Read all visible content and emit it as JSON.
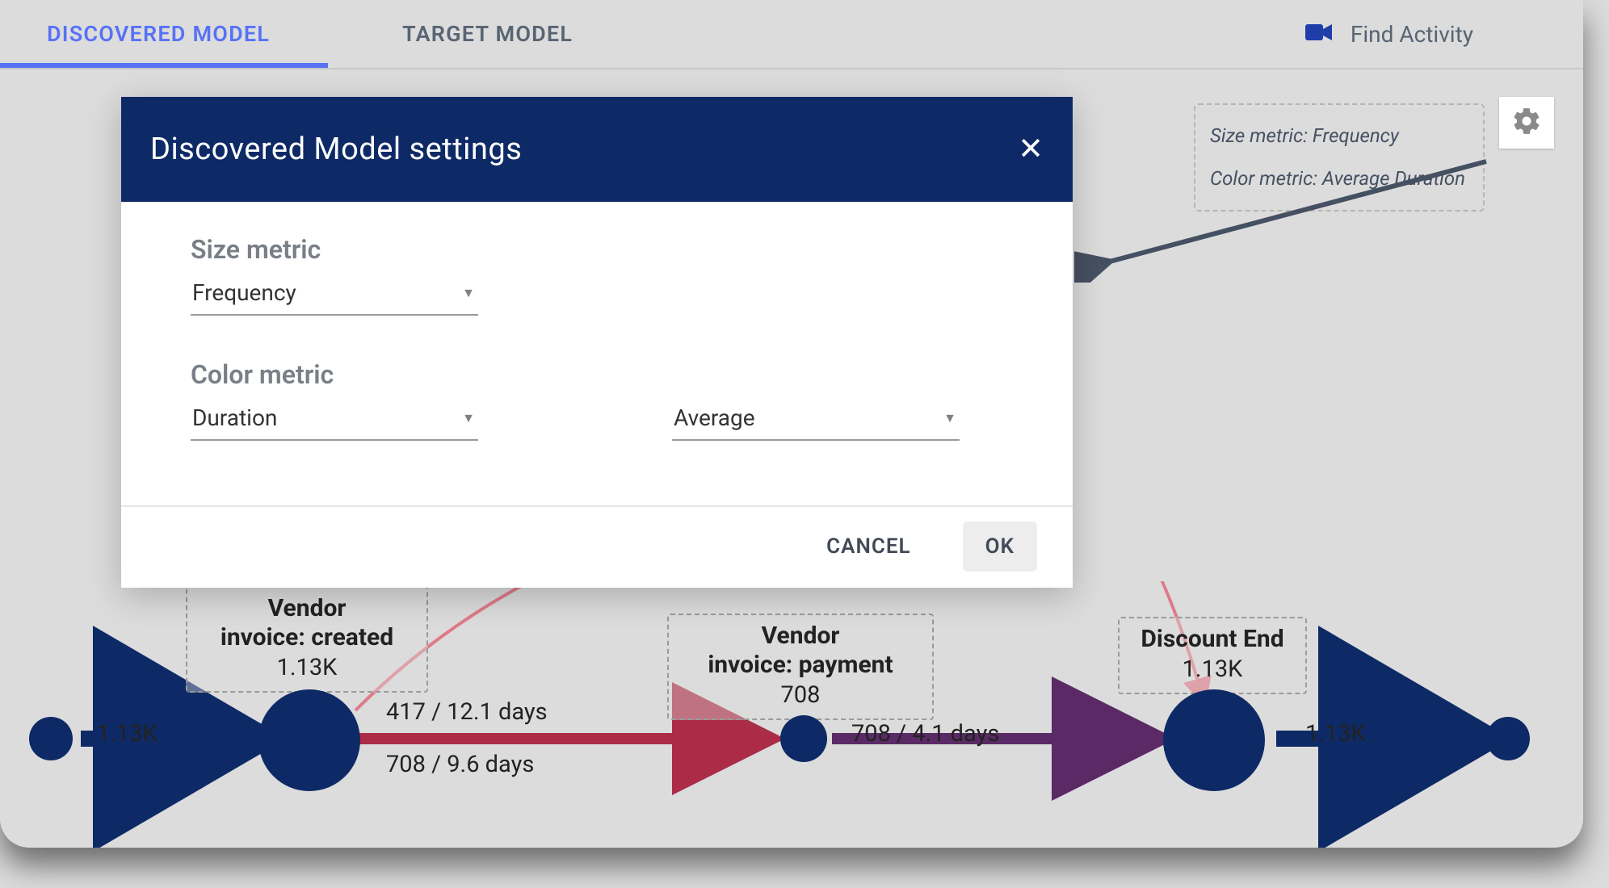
{
  "tabs": {
    "discovered": "DISCOVERED MODEL",
    "target": "TARGET MODEL"
  },
  "topbar": {
    "find_activity": "Find Activity"
  },
  "legend": {
    "size_line": "Size metric: Frequency",
    "color_line": "Color metric: Average Duration"
  },
  "modal": {
    "title": "Discovered Model settings",
    "size_label": "Size metric",
    "size_value": "Frequency",
    "color_label": "Color metric",
    "color_value": "Duration",
    "color_agg": "Average",
    "cancel": "CANCEL",
    "ok": "OK"
  },
  "diagram": {
    "start_label": "1.13K",
    "end_label": "1.13K",
    "node_vendor_created": {
      "title1": "Vendor",
      "title2": "invoice: created",
      "count": "1.13K"
    },
    "node_vendor_payment": {
      "title1": "Vendor",
      "title2": "invoice: payment",
      "count": "708"
    },
    "node_discount_end": {
      "title1": "Discount End",
      "count": "1.13K"
    },
    "edge_created_payment_top": "417 / 12.1 days",
    "edge_created_payment_bottom": "708 / 9.6 days",
    "edge_payment_discount": "708 / 4.1 days"
  },
  "colors": {
    "primary_blue": "#0e2a66",
    "accent_blue": "#5772f6",
    "edge_red": "#aa2c47",
    "edge_pink": "#df7b88",
    "edge_purple": "#5a2a66"
  }
}
